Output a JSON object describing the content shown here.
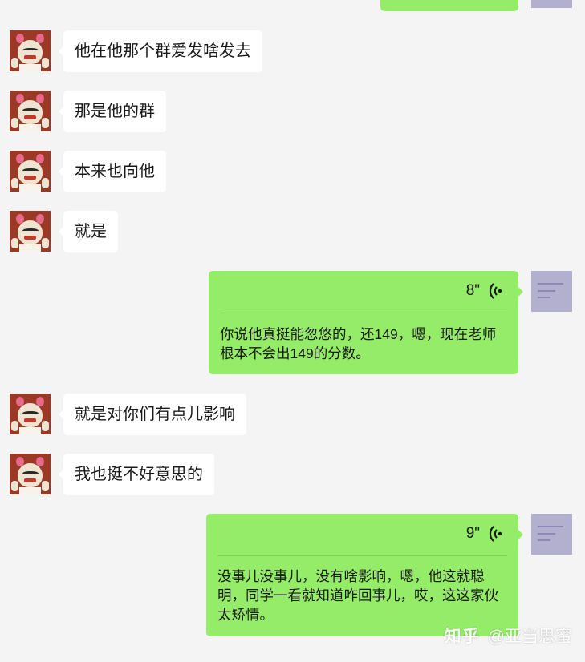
{
  "messages": [
    {
      "side": "left",
      "text": "他在他那个群爱发啥发去"
    },
    {
      "side": "left",
      "text": "那是他的群"
    },
    {
      "side": "left",
      "text": "本来也向他"
    },
    {
      "side": "left",
      "text": "就是"
    },
    {
      "side": "right",
      "type": "voice",
      "duration": "8\"",
      "transcript": "你说他真挺能忽悠的，还149，嗯，现在老师根本不会出149的分数。"
    },
    {
      "side": "left",
      "text": "就是对你们有点儿影响"
    },
    {
      "side": "left",
      "text": "我也挺不好意思的"
    },
    {
      "side": "right",
      "type": "voice",
      "duration": "9\"",
      "transcript": "没事儿没事儿，没有啥影响，嗯，他这就聪明，同学一看就知道咋回事儿，哎，这这家伙太矫情。"
    }
  ],
  "watermark": {
    "logo": "知乎",
    "handle": "@亚当思蜜"
  },
  "colors": {
    "background": "#f4f4f4",
    "self_bubble": "#95ec69",
    "other_bubble": "#ffffff"
  },
  "icons": {
    "voice": "voice-wave-icon"
  }
}
